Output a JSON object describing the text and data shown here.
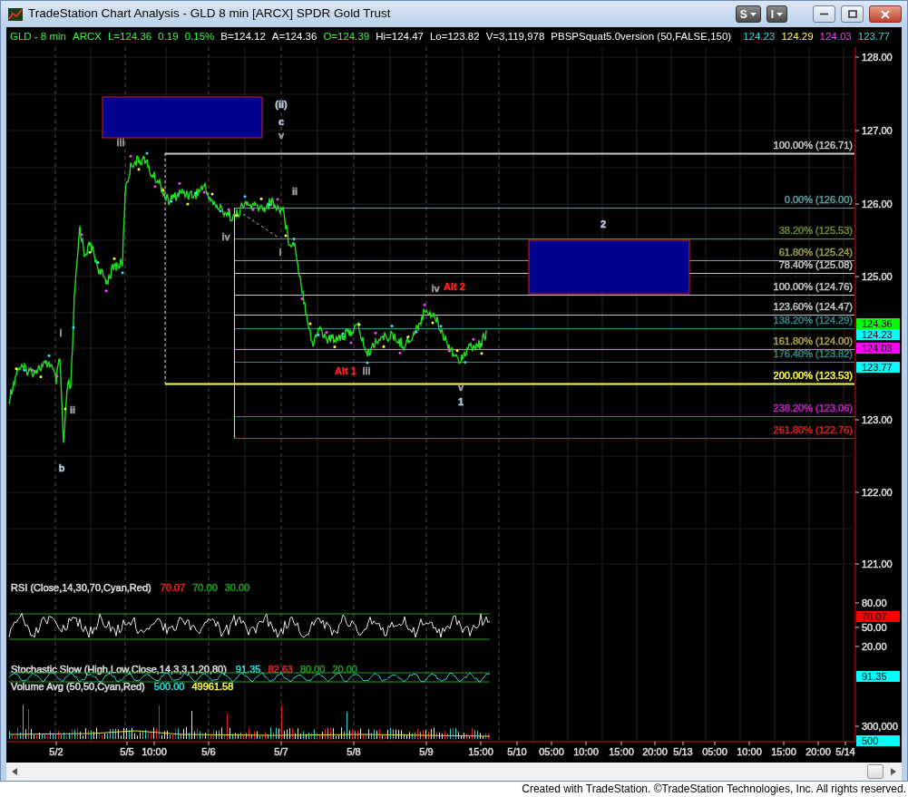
{
  "window": {
    "title": "TradeStation Chart Analysis - GLD 8 min [ARCX] SPDR Gold Trust",
    "menu_buttons": [
      "S",
      "I"
    ]
  },
  "chart": {
    "header": [
      {
        "text": "GLD - 8 min",
        "color": "#33ff33"
      },
      {
        "text": "ARCX",
        "color": "#33ff33"
      },
      {
        "text": "L=124.36",
        "color": "#33ff33"
      },
      {
        "text": "0.19",
        "color": "#33ff33"
      },
      {
        "text": "0.15%",
        "color": "#33ff33"
      },
      {
        "text": "B=124.12",
        "color": "#ffffff"
      },
      {
        "text": "A=124.36",
        "color": "#ffffff"
      },
      {
        "text": "O=124.39",
        "color": "#33ff33"
      },
      {
        "text": "Hi=124.47",
        "color": "#ffffff"
      },
      {
        "text": "Lo=123.82",
        "color": "#ffffff"
      },
      {
        "text": "V=3,119,978",
        "color": "#ffffff"
      },
      {
        "text": "PBSPSquat5.0version (50,FALSE,150)",
        "color": "#ffffff"
      },
      {
        "text": "124.23",
        "color": "#33dddd"
      },
      {
        "text": "124.29",
        "color": "#ffff44"
      },
      {
        "text": "124.03",
        "color": "#ff33ff"
      },
      {
        "text": "123.77",
        "color": "#33dddd"
      }
    ],
    "price_axis": [
      "128.00",
      "127.00",
      "126.00",
      "125.00",
      "123.00",
      "122.00",
      "121.00"
    ],
    "fib_levels": [
      {
        "label": "100.00% (126.71)",
        "color": "#c8c8c8"
      },
      {
        "label": "0.00% (126.00)",
        "color": "#5f9ea0"
      },
      {
        "label": "38.20% (125.53)",
        "color": "#6b8e23"
      },
      {
        "label": "61.80% (125.24)",
        "color": "#a0a040"
      },
      {
        "label": "78.40% (125.08)",
        "color": "#c8c8c8"
      },
      {
        "label": "100.00% (124.76)",
        "color": "#c8c8c8"
      },
      {
        "label": "123.60% (124.47)",
        "color": "#c8c8c8"
      },
      {
        "label": "138.20% (124.29)",
        "color": "#2e8b8b"
      },
      {
        "label": "161.80% (124.00)",
        "color": "#b5a642"
      },
      {
        "label": "176.40% (123.82)",
        "color": "#2e8b8b"
      },
      {
        "label": "200.00% (123.53)",
        "color": "#ffff40"
      },
      {
        "label": "238.20% (123.06)",
        "color": "#d020d0"
      },
      {
        "label": "261.80% (122.76)",
        "color": "#e02020"
      }
    ],
    "price_tags": [
      {
        "text": "124.36",
        "color": "#00ff00"
      },
      {
        "text": "124.23",
        "color": "#00ffff"
      },
      {
        "text": "124.03",
        "color": "#ff00ff"
      },
      {
        "text": "123.77",
        "color": "#00ffff"
      }
    ],
    "wave_labels": [
      {
        "text": "(ii)",
        "color": "#b8c8e0"
      },
      {
        "text": "c",
        "color": "#b8c8e0"
      },
      {
        "text": "v",
        "color": "#a0a0a0"
      },
      {
        "text": "iii",
        "color": "#a0a0a0"
      },
      {
        "text": "ii",
        "color": "#a0a0a0"
      },
      {
        "text": "iv",
        "color": "#a0a0a0"
      },
      {
        "text": "i",
        "color": "#a0a0a0"
      },
      {
        "text": "i",
        "color": "#a0a0a0"
      },
      {
        "text": "ii",
        "color": "#a0a0a0"
      },
      {
        "text": "b",
        "color": "#b8c8e0"
      },
      {
        "text": "iv",
        "color": "#a0a0a0"
      },
      {
        "text": "Alt 2",
        "color": "#ff2020"
      },
      {
        "text": "Alt 1",
        "color": "#ff2020"
      },
      {
        "text": "iii",
        "color": "#a0a0a0"
      },
      {
        "text": "v",
        "color": "#a0a0a0"
      },
      {
        "text": "1",
        "color": "#b8c8e0"
      },
      {
        "text": "2",
        "color": "#b8c8e0"
      }
    ],
    "rsi": {
      "title": "RSI (Close,14,30,70,Cyan,Red)",
      "values": [
        {
          "text": "70.07",
          "color": "#ff2020"
        },
        {
          "text": "70.00",
          "color": "#20a020"
        },
        {
          "text": "30.00",
          "color": "#20a020"
        }
      ],
      "axis": [
        "80.00",
        "50.00",
        "20.00"
      ],
      "tag": {
        "text": "70.07",
        "color": "#ff0000"
      }
    },
    "stochastic": {
      "title": "Stochastic Slow (High,Low,Close,14,3,3,1,20,80)",
      "values": [
        {
          "text": "91.35",
          "color": "#33dddd"
        },
        {
          "text": "82.63",
          "color": "#ff2020"
        },
        {
          "text": "80.00",
          "color": "#20a020"
        },
        {
          "text": "20.00",
          "color": "#20a020"
        }
      ],
      "tag": {
        "text": "91.35",
        "color": "#00ffff"
      }
    },
    "volume": {
      "title": "Volume Avg (50,50,Cyan,Red)",
      "values": [
        {
          "text": "500.00",
          "color": "#33dddd"
        },
        {
          "text": "49961.58",
          "color": "#ffff44"
        }
      ],
      "axis": [
        "300,000"
      ],
      "tag": {
        "text": "500",
        "color": "#00ffff"
      }
    },
    "time_axis": [
      "5/2",
      "5/5",
      "10:00",
      "5/6",
      "5/7",
      "5/8",
      "5/9",
      "15:00",
      "5/10",
      "05:00",
      "10:00",
      "15:00",
      "20:00",
      "5/13",
      "05:00",
      "10:00",
      "15:00",
      "20:00",
      "5/14"
    ]
  },
  "footer": "Created with TradeStation. ©TradeStation Technologies, Inc. All rights reserved."
}
